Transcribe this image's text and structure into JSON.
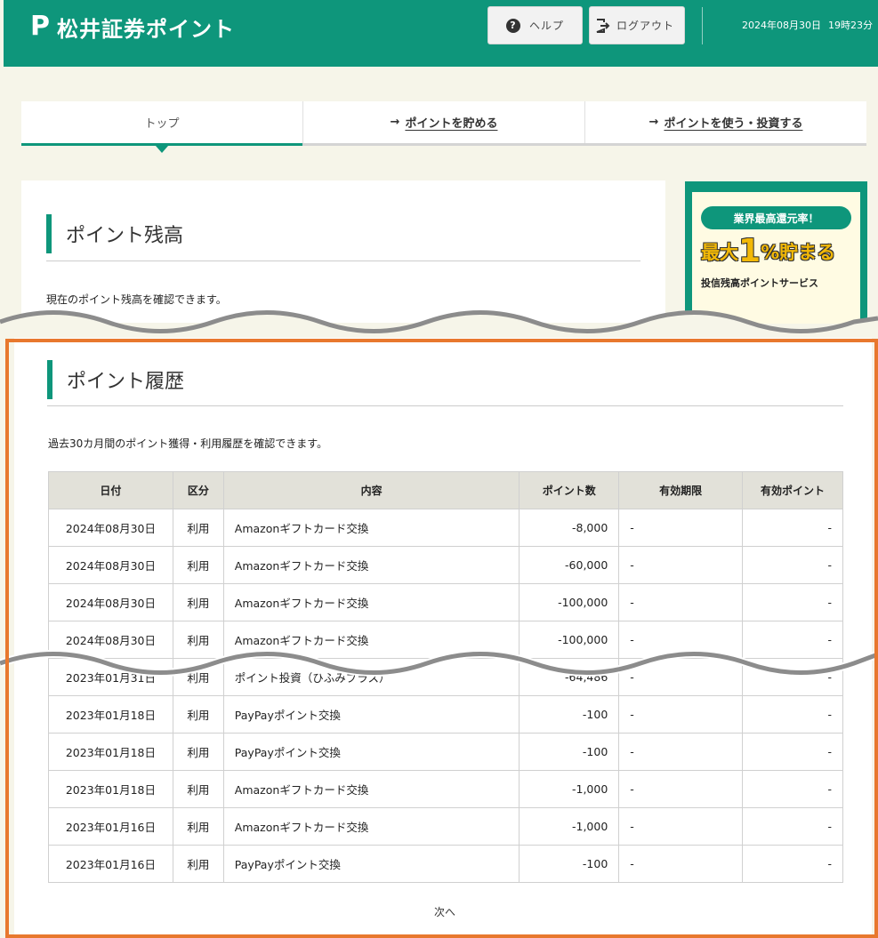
{
  "header": {
    "logo_mark": "P",
    "title": "松井証券ポイント",
    "help_label": "ヘルプ",
    "logout_label": "ログアウト",
    "date": "2024年08月30日",
    "time": "19時23分"
  },
  "nav": {
    "tabs": [
      {
        "label": "トップ"
      },
      {
        "label": "ポイントを貯める"
      },
      {
        "label": "ポイントを使う・投資する"
      }
    ]
  },
  "balance": {
    "title": "ポイント残高",
    "description": "現在のポイント残高を確認できます。"
  },
  "banner": {
    "pill": "業界最高還元率！",
    "main_prefix": "最大",
    "main_number": "1",
    "main_suffix": "%貯まる",
    "sub": "投信残高ポイントサービス"
  },
  "history": {
    "title": "ポイント履歴",
    "description": "過去30カ月間のポイント獲得・利用履歴を確認できます。",
    "columns": [
      "日付",
      "区分",
      "内容",
      "ポイント数",
      "有効期限",
      "有効ポイント"
    ],
    "rows": [
      [
        "2024年08月30日",
        "利用",
        "Amazonギフトカード交換",
        "-8,000",
        "-",
        "-"
      ],
      [
        "2024年08月30日",
        "利用",
        "Amazonギフトカード交換",
        "-60,000",
        "-",
        "-"
      ],
      [
        "2024年08月30日",
        "利用",
        "Amazonギフトカード交換",
        "-100,000",
        "-",
        "-"
      ],
      [
        "2024年08月30日",
        "利用",
        "Amazonギフトカード交換",
        "-100,000",
        "-",
        "-"
      ],
      [
        "2023年01月31日",
        "利用",
        "ポイント投資（ひふみプラス）",
        "-64,486",
        "-",
        "-"
      ],
      [
        "2023年01月18日",
        "利用",
        "PayPayポイント交換",
        "-100",
        "-",
        "-"
      ],
      [
        "2023年01月18日",
        "利用",
        "PayPayポイント交換",
        "-100",
        "-",
        "-"
      ],
      [
        "2023年01月18日",
        "利用",
        "Amazonギフトカード交換",
        "-1,000",
        "-",
        "-"
      ],
      [
        "2023年01月16日",
        "利用",
        "Amazonギフトカード交換",
        "-1,000",
        "-",
        "-"
      ],
      [
        "2023年01月16日",
        "利用",
        "PayPayポイント交換",
        "-100",
        "-",
        "-"
      ]
    ],
    "next_label": "次へ"
  },
  "colors": {
    "brand_green": "#0e967b",
    "page_bg": "#f6f5e9",
    "highlight_frame": "#e8782e",
    "table_header_bg": "#e2e1d9"
  }
}
